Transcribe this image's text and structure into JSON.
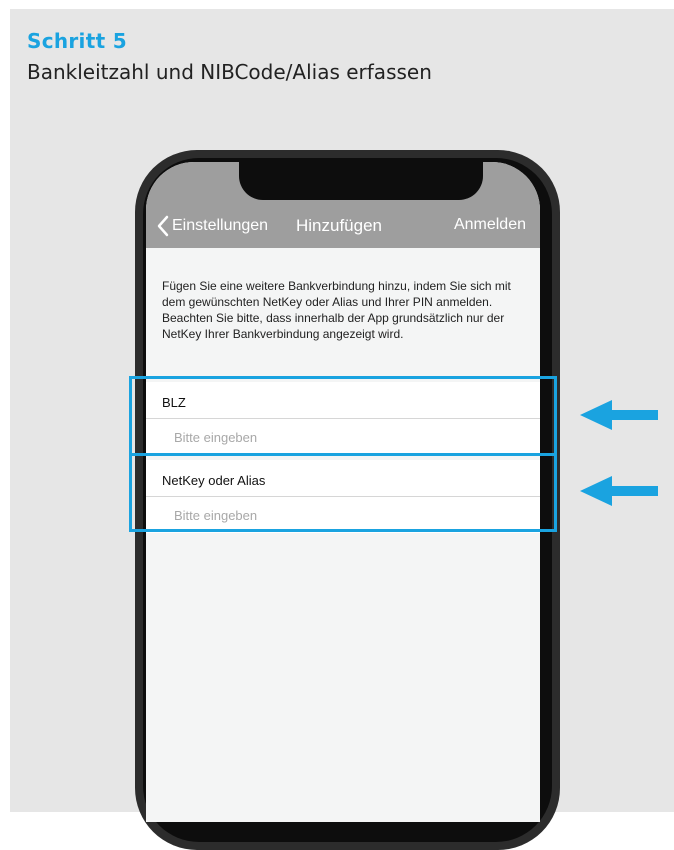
{
  "header": {
    "step": "Schritt 5",
    "subtitle": "Bankleitzahl und NIBCode/Alias erfassen"
  },
  "app": {
    "nav": {
      "back_label": "Einstellungen",
      "title": "Hinzufügen",
      "action_label": "Anmelden"
    },
    "info": {
      "paragraph1": "Fügen Sie eine weitere Bankverbindung hinzu, indem Sie sich mit dem gewünschten NetKey oder Alias und Ihrer PIN anmelden.",
      "paragraph2": "Beachten Sie bitte, dass innerhalb der App grundsätzlich nur der NetKey Ihrer Bankverbindung angezeigt wird."
    },
    "fields": [
      {
        "label": "BLZ",
        "value": "",
        "placeholder": "Bitte eingeben"
      },
      {
        "label": "NetKey oder Alias",
        "value": "",
        "placeholder": "Bitte eingeben"
      }
    ]
  },
  "colors": {
    "accent": "#1aa3e0",
    "background": "#e6e6e6",
    "navbar": "#9e9e9e"
  },
  "icons": {
    "back": "chevron-left-icon",
    "pointer": "arrow-left-icon"
  }
}
